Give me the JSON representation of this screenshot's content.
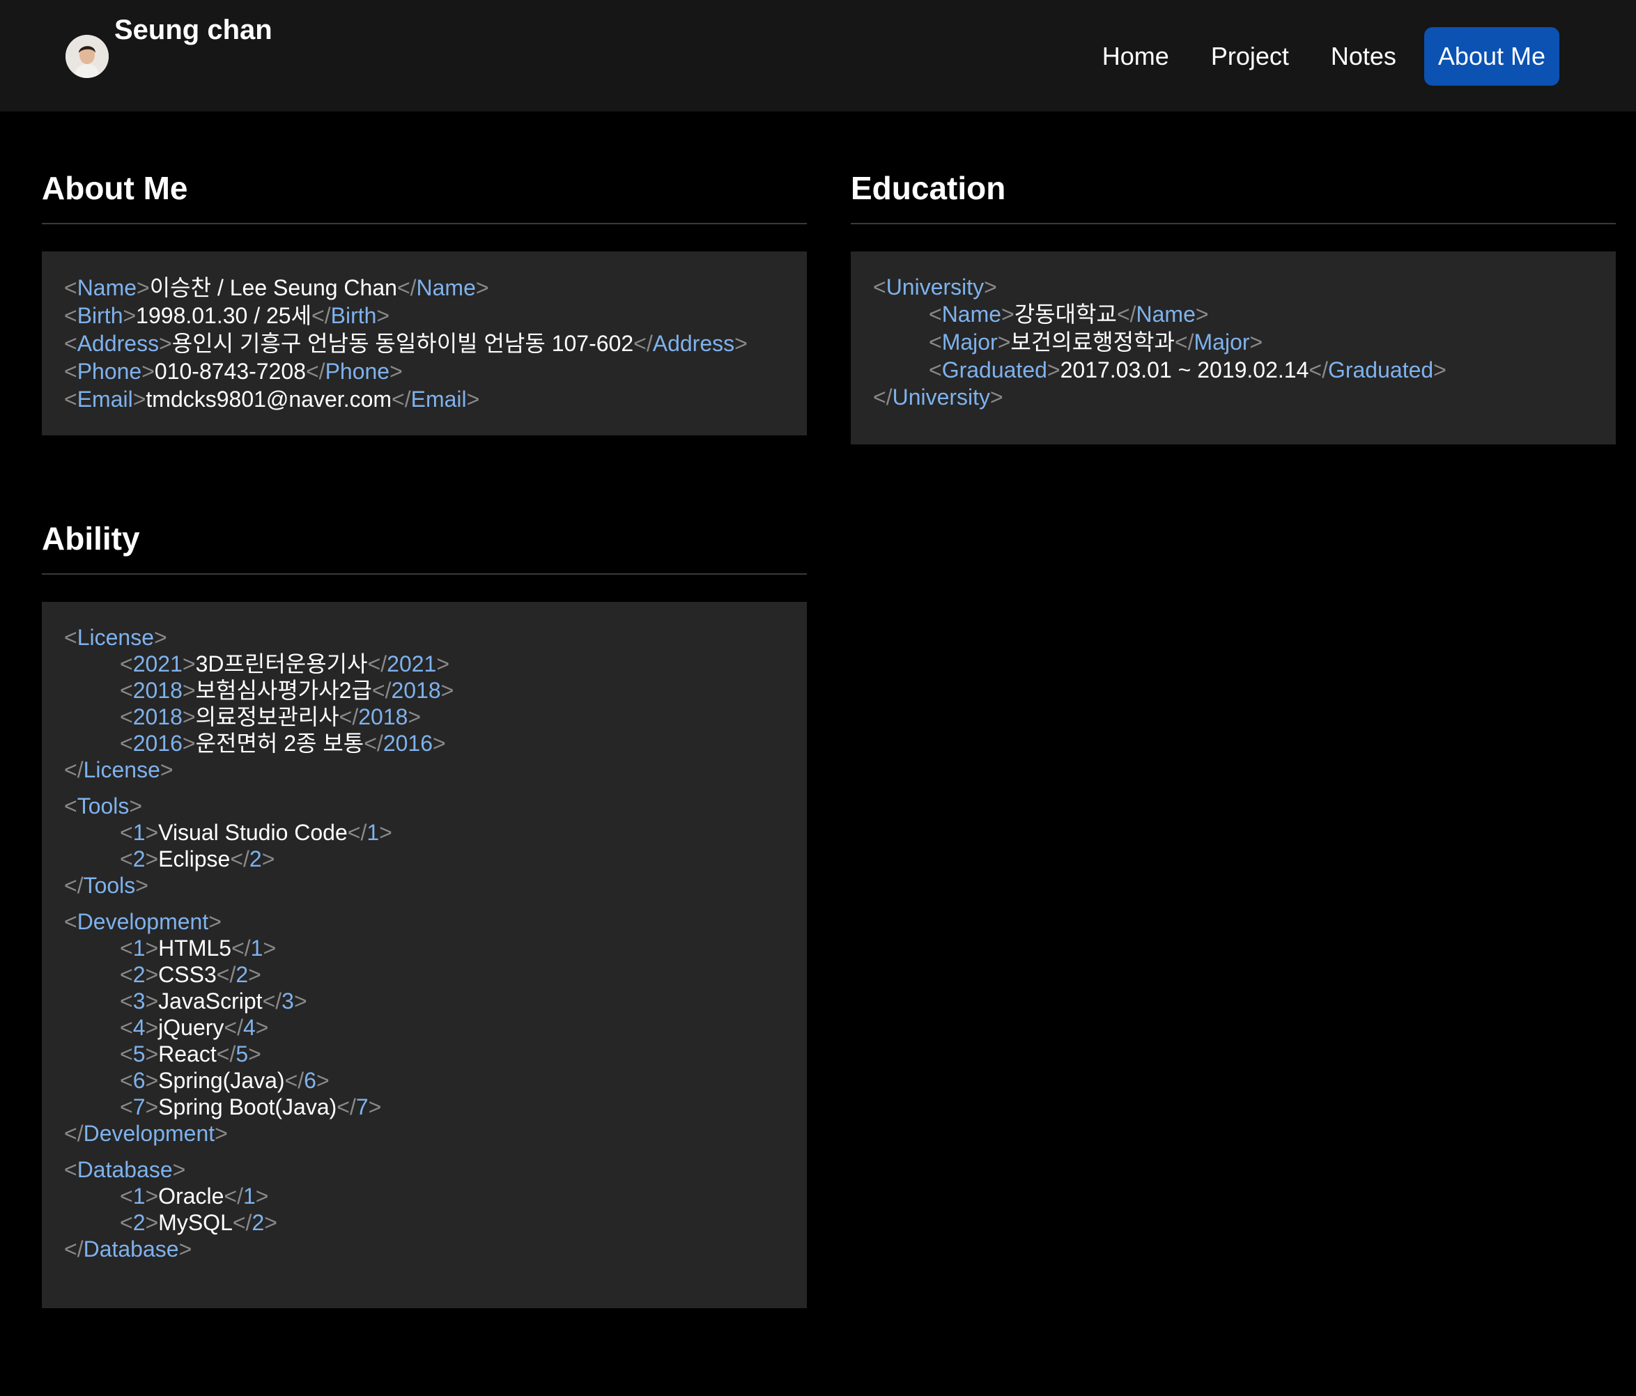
{
  "nav": {
    "brand_text": "Seung chan",
    "links": [
      "Home",
      "Project",
      "Notes",
      "About Me"
    ],
    "active": "About Me"
  },
  "about": {
    "title": "About Me",
    "rows": [
      {
        "tag": "Name",
        "value": "이승찬 / Lee Seung Chan"
      },
      {
        "tag": "Birth",
        "value": "1998.01.30 / 25세"
      },
      {
        "tag": "Address",
        "value": "용인시 기흥구 언남동 동일하이빌 언남동 107-602"
      },
      {
        "tag": "Phone",
        "value": "010-8743-7208"
      },
      {
        "tag": "Email",
        "value": "tmdcks9801@naver.com"
      }
    ]
  },
  "education": {
    "title": "Education",
    "group_tag": "University",
    "rows": [
      {
        "tag": "Name",
        "value": "강동대학교"
      },
      {
        "tag": "Major",
        "value": "보건의료행정학과"
      },
      {
        "tag": "Graduated",
        "value": "2017.03.01 ~ 2019.02.14"
      }
    ]
  },
  "ability": {
    "title": "Ability",
    "groups": [
      {
        "tag": "License",
        "items": [
          {
            "tag": "2021",
            "value": "3D프린터운용기사"
          },
          {
            "tag": "2018",
            "value": "보험심사평가사2급"
          },
          {
            "tag": "2018",
            "value": "의료정보관리사"
          },
          {
            "tag": "2016",
            "value": "운전면허 2종 보통"
          }
        ]
      },
      {
        "tag": "Tools",
        "items": [
          {
            "tag": "1",
            "value": "Visual Studio Code"
          },
          {
            "tag": "2",
            "value": "Eclipse"
          }
        ]
      },
      {
        "tag": "Development",
        "items": [
          {
            "tag": "1",
            "value": "HTML5"
          },
          {
            "tag": "2",
            "value": "CSS3"
          },
          {
            "tag": "3",
            "value": "JavaScript"
          },
          {
            "tag": "4",
            "value": "jQuery"
          },
          {
            "tag": "5",
            "value": "React"
          },
          {
            "tag": "6",
            "value": "Spring(Java)"
          },
          {
            "tag": "7",
            "value": "Spring Boot(Java)"
          }
        ]
      },
      {
        "tag": "Database",
        "items": [
          {
            "tag": "1",
            "value": "Oracle"
          },
          {
            "tag": "2",
            "value": "MySQL"
          }
        ]
      }
    ]
  },
  "colors": {
    "background": "#000000",
    "navbar": "#161616",
    "panel": "#262626",
    "accent": "#0b52b3",
    "tag_name": "#7fb2ed",
    "bracket": "#8a8a8a"
  }
}
